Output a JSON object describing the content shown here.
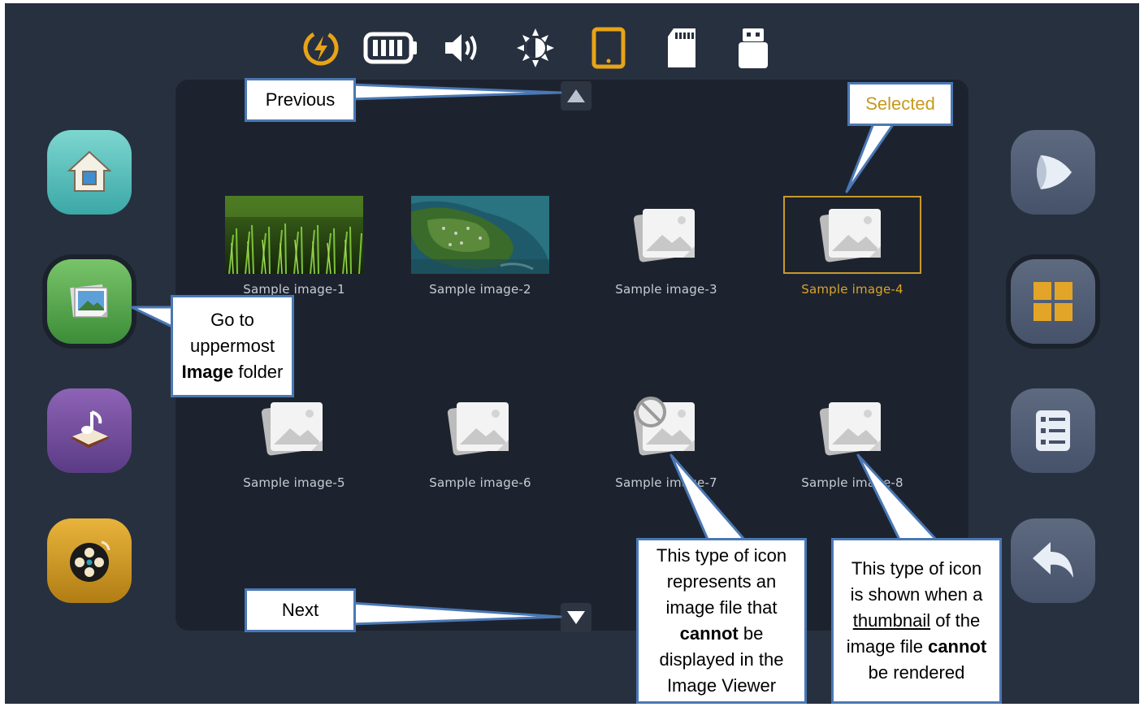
{
  "status_bar": {
    "icons": [
      "charging-bolt-icon",
      "battery-full-icon",
      "volume-icon",
      "brightness-icon",
      "tablet-icon",
      "sd-card-icon",
      "usb-drive-icon"
    ],
    "active_icon": "tablet-icon"
  },
  "gallery": {
    "items": [
      {
        "label": "Sample image-1",
        "kind": "photo-grass"
      },
      {
        "label": "Sample image-2",
        "kind": "photo-aerial"
      },
      {
        "label": "Sample image-3",
        "kind": "placeholder"
      },
      {
        "label": "Sample image-4",
        "kind": "placeholder",
        "selected": true
      },
      {
        "label": "Sample image-5",
        "kind": "placeholder"
      },
      {
        "label": "Sample image-6",
        "kind": "placeholder"
      },
      {
        "label": "Sample image-7",
        "kind": "unsupported"
      },
      {
        "label": "Sample image-8",
        "kind": "placeholder"
      }
    ]
  },
  "left_nav": [
    "home-button",
    "image-folder-button",
    "music-button",
    "video-button"
  ],
  "right_nav": [
    "slideshow-button",
    "grid-view-button",
    "list-view-button",
    "back-button"
  ],
  "callouts": {
    "previous": "Previous",
    "next": "Next",
    "selected": "Selected",
    "folder_line1": "Go to",
    "folder_line2": "uppermost",
    "folder_bold": "Image",
    "folder_tail": " folder",
    "cannot_display": {
      "l1": "This type of icon",
      "l2": "represents an",
      "l3": "image file that",
      "bold": "cannot",
      "l4_tail": " be",
      "l5": "displayed in the",
      "l6": "Image Viewer"
    },
    "no_thumbnail": {
      "l1": "This type of icon",
      "l2": "is shown when a",
      "underline": "thumbnail",
      "l3_tail": " of the",
      "l4_head": "image file ",
      "bold": "cannot",
      "l5": "be rendered"
    }
  },
  "colors": {
    "background": "#27303f",
    "panel": "#1d232e",
    "accent": "#d9a42b",
    "callout_border": "#4a78b5"
  }
}
